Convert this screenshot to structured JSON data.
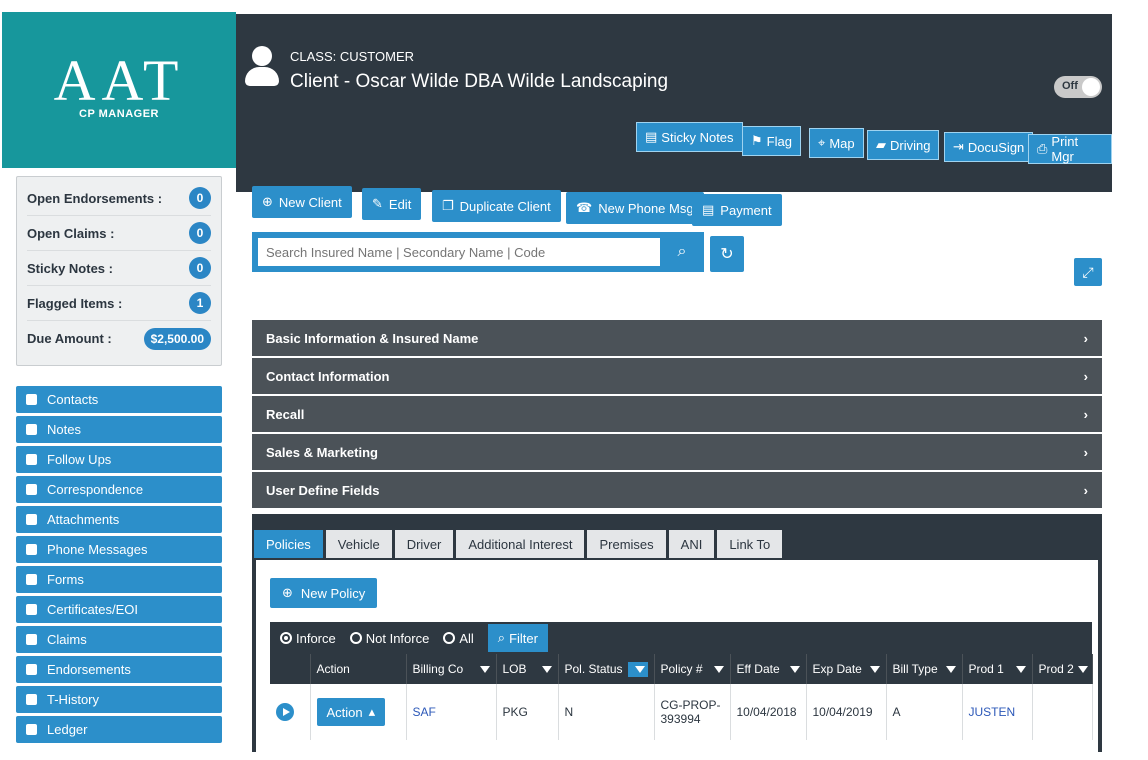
{
  "brand": {
    "logo": "AAT",
    "subtitle": "CP MANAGER"
  },
  "header": {
    "client_class": "CLASS: CUSTOMER",
    "client_name": "Client - Oscar Wilde DBA Wilde Landscaping",
    "toggle_label": "Off",
    "buttons": [
      "Sticky Notes",
      "Flag",
      "Map",
      "Driving",
      "DocuSign",
      "Print Mgr"
    ]
  },
  "stats": [
    {
      "label": "Open Endorsements :",
      "value": "0"
    },
    {
      "label": "Open Claims :",
      "value": "0"
    },
    {
      "label": "Sticky Notes :",
      "value": "0"
    },
    {
      "label": "Flagged Items :",
      "value": "1"
    },
    {
      "label": "Due Amount :",
      "value": "$2,500.00"
    }
  ],
  "nav": [
    "Contacts",
    "Notes",
    "Follow Ups",
    "Correspondence",
    "Attachments",
    "Phone Messages",
    "Forms",
    "Certificates/EOI",
    "Claims",
    "Endorsements",
    "T-History",
    "Ledger"
  ],
  "actions": [
    "New Client",
    "Edit",
    "Duplicate Client",
    "New Phone Msg",
    "Payment"
  ],
  "search": {
    "placeholder": "Search Insured Name | Secondary Name | Code"
  },
  "accordion": [
    "Basic Information & Insured Name",
    "Contact Information",
    "Recall",
    "Sales & Marketing",
    "User Define Fields"
  ],
  "tabs": [
    "Policies",
    "Vehicle",
    "Driver",
    "Additional Interest",
    "Premises",
    "ANI",
    "Link To"
  ],
  "policies": {
    "new_policy": "New Policy",
    "radios": [
      "Inforce",
      "Not Inforce",
      "All"
    ],
    "filter": "Filter",
    "columns": [
      "Action",
      "Billing Co",
      "LOB",
      "Pol. Status",
      "Policy #",
      "Eff Date",
      "Exp Date",
      "Bill Type",
      "Prod 1",
      "Prod 2"
    ],
    "rows": [
      {
        "action": "Action",
        "billing_co": "SAF",
        "lob": "PKG",
        "status": "N",
        "policy": "CG-PROP-393994",
        "eff": "10/04/2018",
        "exp": "10/04/2019",
        "bill_type": "A",
        "prod1": "JUSTEN",
        "prod2": ""
      }
    ]
  },
  "colors": {
    "teal": "#17979c",
    "dark": "#2e3841",
    "blue": "#2c8fca",
    "accordion": "#4b5258"
  }
}
